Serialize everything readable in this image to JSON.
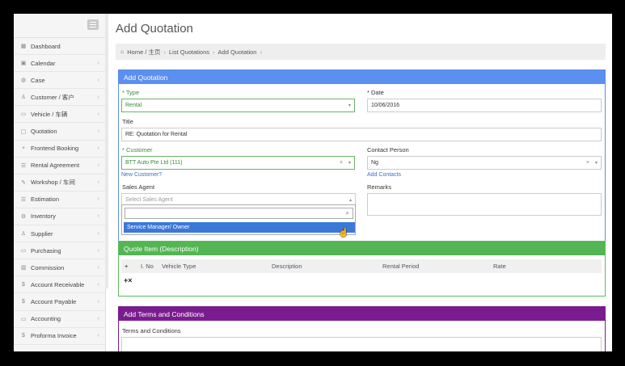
{
  "sidebar": {
    "items": [
      {
        "icon": "dashboard-icon",
        "glyph": "▦",
        "label": "Dashboard",
        "chevron": false
      },
      {
        "icon": "calendar-icon",
        "glyph": "▣",
        "label": "Calendar",
        "chevron": true
      },
      {
        "icon": "case-icon",
        "glyph": "◍",
        "label": "Case",
        "chevron": true
      },
      {
        "icon": "user-icon",
        "glyph": "♙",
        "label": "Customer / 客户",
        "chevron": true
      },
      {
        "icon": "car-icon",
        "glyph": "▭",
        "label": "Vehicle / 车辆",
        "chevron": true
      },
      {
        "icon": "quotation-icon",
        "glyph": "▢",
        "label": "Quotation",
        "chevron": true
      },
      {
        "icon": "plus-icon",
        "glyph": "+",
        "label": "Frontend Booking",
        "chevron": true
      },
      {
        "icon": "list-icon",
        "glyph": "☰",
        "label": "Rental Agreement",
        "chevron": true
      },
      {
        "icon": "wrench-icon",
        "glyph": "✎",
        "label": "Workshop / 车间",
        "chevron": true
      },
      {
        "icon": "list-icon",
        "glyph": "☰",
        "label": "Estimation",
        "chevron": true
      },
      {
        "icon": "gear-icon",
        "glyph": "⚙",
        "label": "Inventory",
        "chevron": true
      },
      {
        "icon": "user-icon",
        "glyph": "♙",
        "label": "Supplier",
        "chevron": true
      },
      {
        "icon": "truck-icon",
        "glyph": "▭",
        "label": "Purchasing",
        "chevron": true
      },
      {
        "icon": "bar-chart-icon",
        "glyph": "▥",
        "label": "Commission",
        "chevron": true
      },
      {
        "icon": "dollar-icon",
        "glyph": "$",
        "label": "Account Receivable",
        "chevron": true
      },
      {
        "icon": "dollar-icon",
        "glyph": "$",
        "label": "Account Payable",
        "chevron": true
      },
      {
        "icon": "folder-icon",
        "glyph": "▭",
        "label": "Accounting",
        "chevron": true
      },
      {
        "icon": "dollar-icon",
        "glyph": "$",
        "label": "Proforma Invoice",
        "chevron": true
      }
    ]
  },
  "page": {
    "title": "Add Quotation"
  },
  "breadcrumb": {
    "home": "Home / 主页",
    "list": "List Quotations",
    "current": "Add Quotation"
  },
  "quotation": {
    "header": "Add Quotation",
    "type_label": "Type",
    "type_value": "Rental",
    "date_label": "Date",
    "date_value": "10/06/2016",
    "title_label": "Title",
    "title_value": "RE: Quotation for Rental",
    "customer_label": "Customer",
    "customer_value": "BTT Auto Pte Ltd (111)",
    "new_customer_link": "New Customer?",
    "contact_label": "Contact Person",
    "contact_value": "Ng",
    "add_contacts_link": "Add Contacts",
    "sales_agent_label": "Sales Agent",
    "sales_agent_placeholder": "Select Sales Agent",
    "sales_agent_option": "Service Manager/ Owner",
    "remarks_label": "Remarks",
    "required_mark": "*"
  },
  "quote_items": {
    "header": "Quote Item (Description)",
    "columns": [
      "+",
      "I. No",
      "Vehicle Type",
      "Description",
      "Rental Period",
      "Rate"
    ],
    "row_tools": "+×"
  },
  "terms": {
    "header": "Add Terms and Conditions",
    "label": "Terms and Conditions"
  },
  "colors": {
    "blue": "#5b8ff0",
    "green": "#53b553",
    "purple": "#7a1c8f"
  }
}
